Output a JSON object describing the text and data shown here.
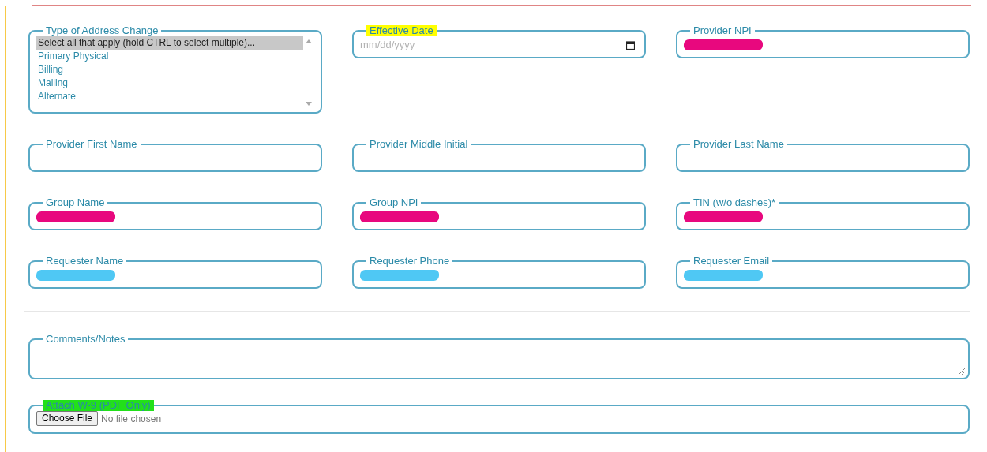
{
  "rows": [
    {
      "fields": [
        {
          "kind": "listbox",
          "label": "Type of Address Change",
          "options": [
            {
              "text": "Select all that apply (hold CTRL to select multiple)...",
              "selected": true
            },
            {
              "text": "Primary Physical",
              "selected": false
            },
            {
              "text": "Billing",
              "selected": false
            },
            {
              "text": "Mailing",
              "selected": false
            },
            {
              "text": "Alternate",
              "selected": false
            }
          ]
        },
        {
          "kind": "date",
          "label": "Effective Date",
          "color": "#ffff00",
          "placeholder": "mm/dd/yyyy"
        },
        {
          "kind": "text",
          "label": "Provider NPI",
          "color": "#e8087e"
        }
      ]
    },
    {
      "fields": [
        {
          "kind": "text",
          "label": "Provider First Name"
        },
        {
          "kind": "text",
          "label": "Provider Middle Initial"
        },
        {
          "kind": "text",
          "label": "Provider Last Name"
        }
      ]
    },
    {
      "fields": [
        {
          "kind": "text",
          "label": "Group Name",
          "color": "#e8087e"
        },
        {
          "kind": "text",
          "label": "Group NPI",
          "color": "#e8087e"
        },
        {
          "kind": "text",
          "label": "TIN (w/o dashes)*",
          "color": "#e8087e"
        }
      ]
    },
    {
      "fields": [
        {
          "kind": "text",
          "label": "Requester Name",
          "color": "#4fc8f4"
        },
        {
          "kind": "text",
          "label": "Requester Phone",
          "color": "#4fc8f4"
        },
        {
          "kind": "text",
          "label": "Requester Email",
          "color": "#4fc8f4"
        }
      ]
    }
  ],
  "comments": {
    "kind": "textarea",
    "label": "Comments/Notes"
  },
  "attachment": {
    "kind": "file",
    "label": "Attach W-9 (PDF Only)",
    "color": "#22e01a",
    "button": "Choose File",
    "status": "No file chosen"
  }
}
